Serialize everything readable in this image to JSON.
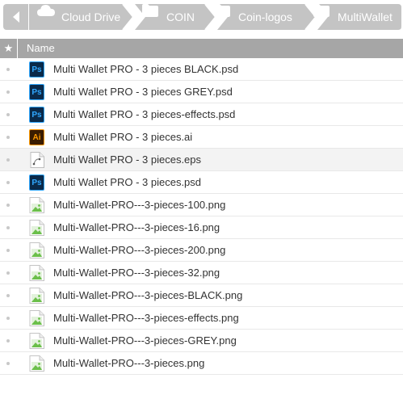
{
  "breadcrumb": {
    "back_icon": "triangle-left-icon",
    "items": [
      {
        "label": "Cloud Drive",
        "icon": "cloud-icon"
      },
      {
        "label": "COIN",
        "icon": "folder-icon"
      },
      {
        "label": "Coin-logos",
        "icon": "folder-icon"
      },
      {
        "label": "MultiWallet",
        "icon": "folder-icon"
      }
    ]
  },
  "colors": {
    "crumb_bg": "#c4c4c4",
    "header_bg": "#a6a6a6",
    "ps_blue": "#31a8ff",
    "ai_orange": "#ff9a00",
    "image_icon_green": "#6bbf4a"
  },
  "table": {
    "star_symbol": "★",
    "name_header": "Name",
    "files": [
      {
        "name": "Multi Wallet PRO - 3 pieces BLACK.psd",
        "type": "psd",
        "badge": "Ps"
      },
      {
        "name": "Multi Wallet PRO - 3 pieces GREY.psd",
        "type": "psd",
        "badge": "Ps"
      },
      {
        "name": "Multi Wallet PRO - 3 pieces-effects.psd",
        "type": "psd",
        "badge": "Ps"
      },
      {
        "name": "Multi Wallet PRO - 3 pieces.ai",
        "type": "ai",
        "badge": "Ai"
      },
      {
        "name": "Multi Wallet PRO - 3 pieces.eps",
        "type": "eps",
        "badge": ""
      },
      {
        "name": "Multi Wallet PRO - 3 pieces.psd",
        "type": "psd",
        "badge": "Ps"
      },
      {
        "name": "Multi-Wallet-PRO---3-pieces-100.png",
        "type": "png",
        "badge": ""
      },
      {
        "name": "Multi-Wallet-PRO---3-pieces-16.png",
        "type": "png",
        "badge": ""
      },
      {
        "name": "Multi-Wallet-PRO---3-pieces-200.png",
        "type": "png",
        "badge": ""
      },
      {
        "name": "Multi-Wallet-PRO---3-pieces-32.png",
        "type": "png",
        "badge": ""
      },
      {
        "name": "Multi-Wallet-PRO---3-pieces-BLACK.png",
        "type": "png",
        "badge": ""
      },
      {
        "name": "Multi-Wallet-PRO---3-pieces-effects.png",
        "type": "png",
        "badge": ""
      },
      {
        "name": "Multi-Wallet-PRO---3-pieces-GREY.png",
        "type": "png",
        "badge": ""
      },
      {
        "name": "Multi-Wallet-PRO---3-pieces.png",
        "type": "png",
        "badge": ""
      }
    ]
  }
}
